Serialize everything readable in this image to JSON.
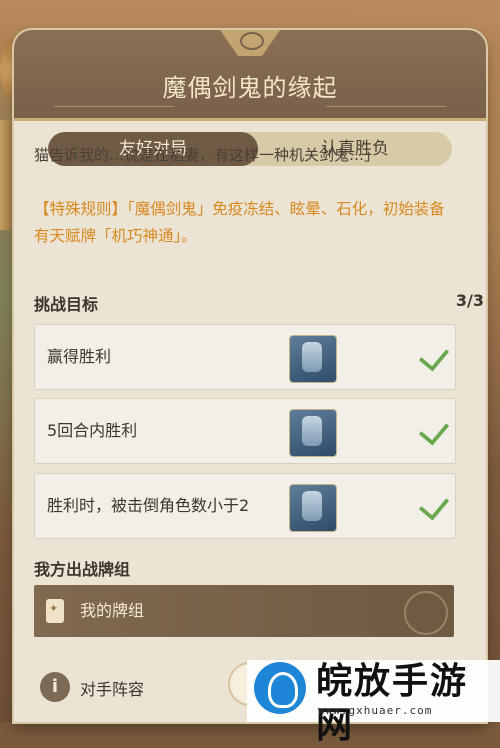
{
  "header": {
    "title": "魔偶剑鬼的缘起"
  },
  "tabs": [
    {
      "label": "友好对局",
      "active": true
    },
    {
      "label": "认真胜负",
      "active": false
    }
  ],
  "description": {
    "intro": "猫告诉我的…说是在稻妻，有这样一种机关剑鬼…」",
    "rule": "【特殊规则】「魔偶剑鬼」免疫冻结、眩晕、石化，初始装备有天赋牌「机巧神通」。"
  },
  "challenge": {
    "heading": "挑战目标",
    "count": "3/3",
    "goals": [
      {
        "text": "赢得胜利",
        "completed": true,
        "card_icon": "card-icon"
      },
      {
        "text": "5回合内胜利",
        "completed": true,
        "card_icon": "card-icon"
      },
      {
        "text": "胜利时，被击倒角色数小于2",
        "completed": true,
        "card_icon": "card-icon"
      }
    ]
  },
  "deck": {
    "heading": "我方出战牌组",
    "label": "我的牌组"
  },
  "opponent": {
    "label": "对手阵容"
  },
  "watermark": {
    "title": "皖放手游网",
    "url": "www.gxhuaer.com"
  },
  "colors": {
    "accent": "#6f5a44",
    "rule_text": "#d68a1f",
    "check": "#6aa84f"
  }
}
